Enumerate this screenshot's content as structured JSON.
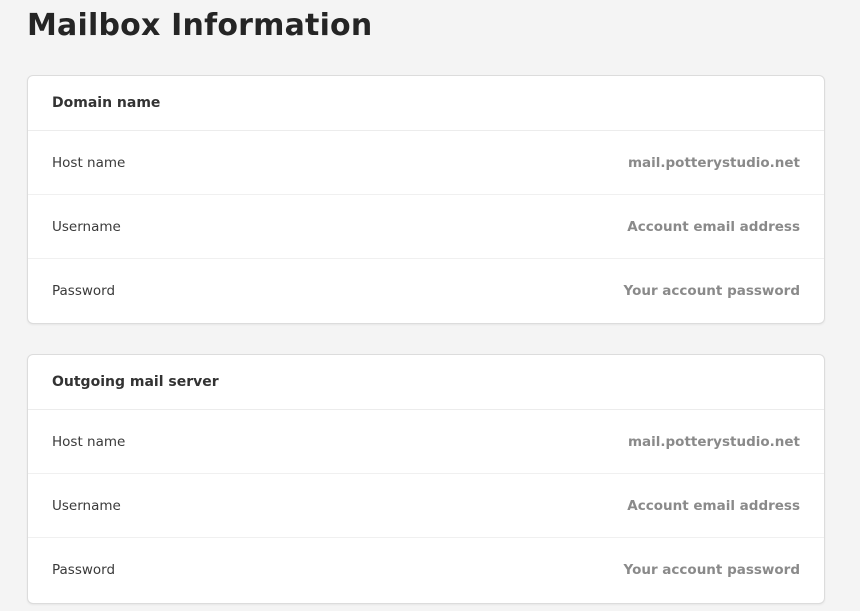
{
  "page": {
    "title": "Mailbox Information"
  },
  "sections": [
    {
      "header": "Domain name",
      "rows": [
        {
          "label": "Host name",
          "value": "mail.potterystudio.net"
        },
        {
          "label": "Username",
          "value": "Account email address"
        },
        {
          "label": "Password",
          "value": "Your account password"
        }
      ]
    },
    {
      "header": "Outgoing mail server",
      "rows": [
        {
          "label": "Host name",
          "value": "mail.potterystudio.net"
        },
        {
          "label": "Username",
          "value": "Account email address"
        },
        {
          "label": "Password",
          "value": "Your account password"
        }
      ]
    }
  ],
  "colors": {
    "background": "#f4f4f4",
    "card": "#ffffff",
    "value_text": "#8a8a8a",
    "label_text": "#3a3a3a"
  }
}
